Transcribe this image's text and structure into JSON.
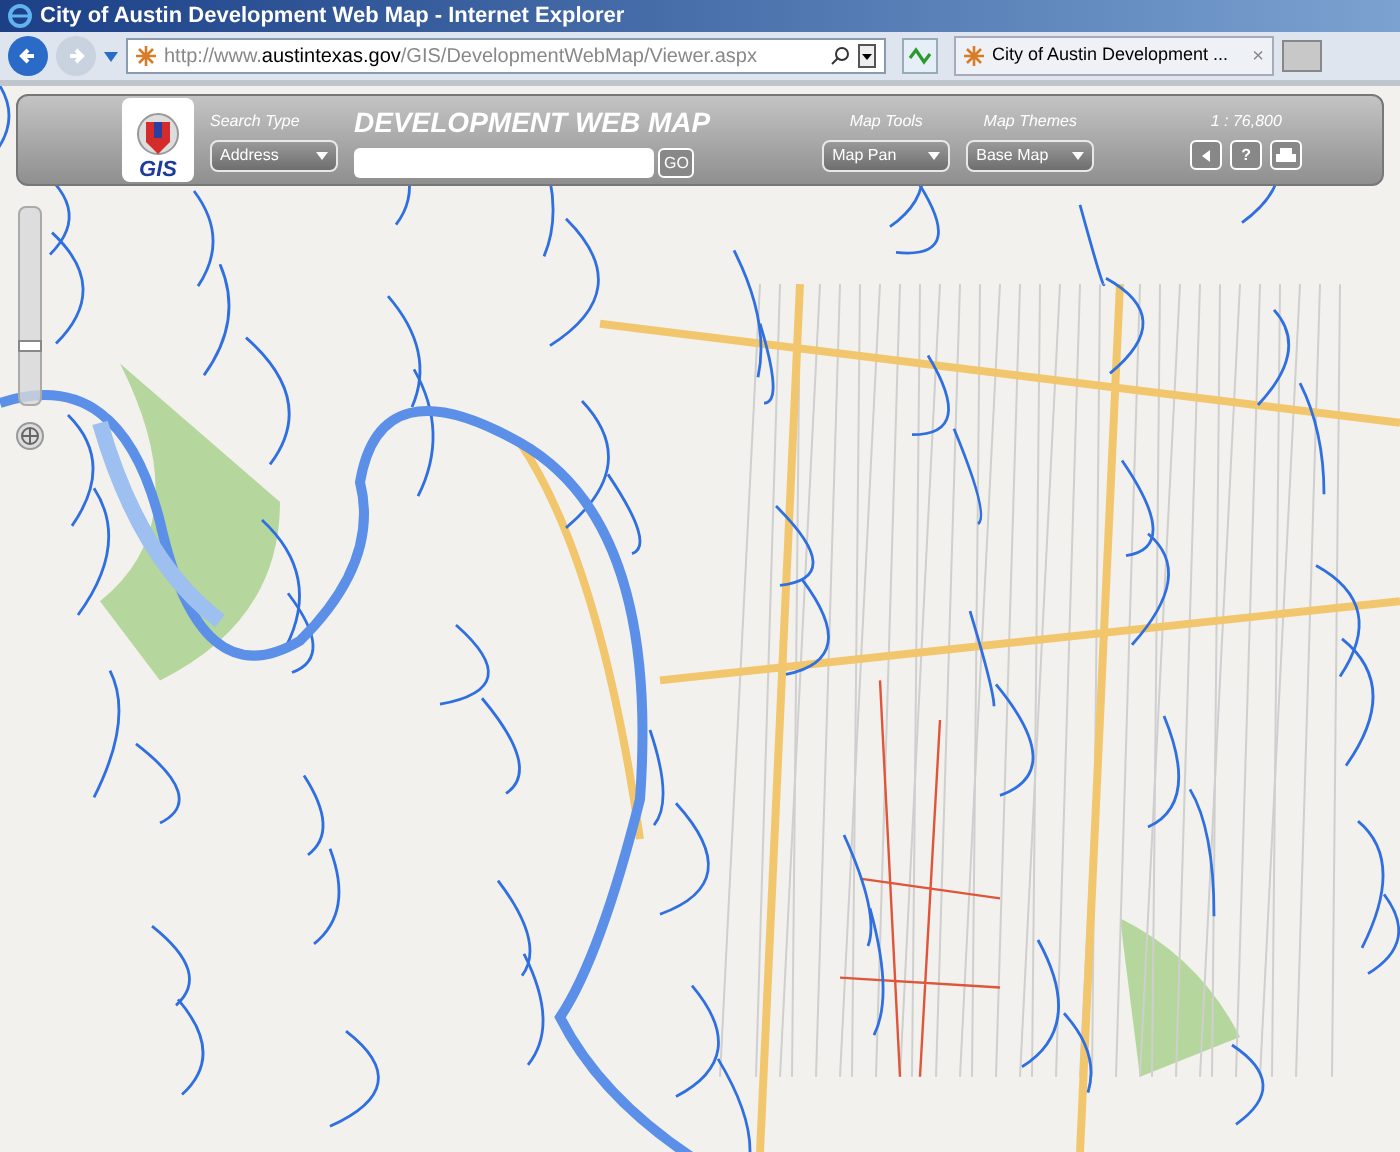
{
  "window": {
    "title": "City of Austin Development Web Map - Internet Explorer"
  },
  "address_bar": {
    "url_prefix": "http://www.",
    "url_domain": "austintexas.gov",
    "url_path": "/GIS/DevelopmentWebMap/Viewer.aspx"
  },
  "tab": {
    "label": "City of Austin Development ...",
    "close": "×"
  },
  "toolbar": {
    "logo_text": "GIS",
    "title": "DEVELOPMENT WEB MAP",
    "search_type": {
      "label": "Search Type",
      "value": "Address"
    },
    "search": {
      "button": "GO"
    },
    "map_tools": {
      "label": "Map Tools",
      "value": "Map Pan"
    },
    "map_themes": {
      "label": "Map Themes",
      "value": "Base Map"
    },
    "scale": "1 : 76,800",
    "help": "?"
  },
  "zoom_slider": {
    "level": 0.3
  }
}
